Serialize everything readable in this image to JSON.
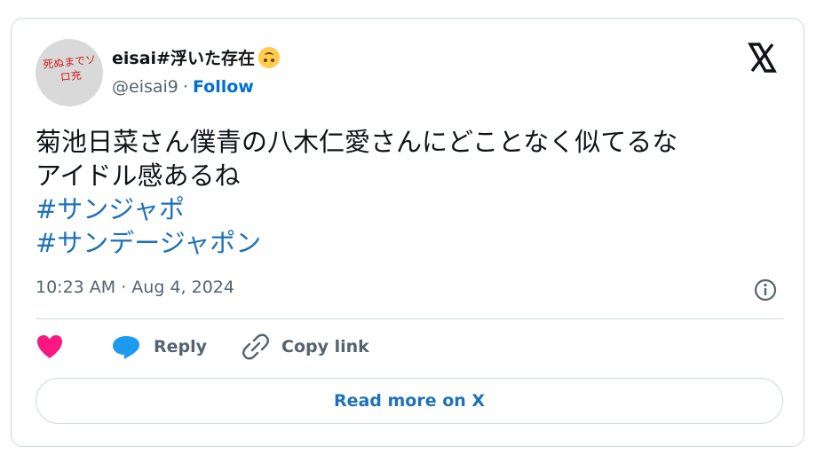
{
  "author": {
    "avatar_text": "死ぬまでソロ充",
    "display_name": "eisai#浮いた存在",
    "emoji_icon": "upside-down-face-icon",
    "handle": "@eisai9",
    "separator": "·",
    "follow_label": "Follow"
  },
  "tweet": {
    "text_line1": "菊池日菜さん僕青の八木仁愛さんにどことなく似てるな",
    "text_line2": "アイドル感あるね",
    "hashtag1": "#サンジャポ",
    "hashtag2": "#サンデージャポン",
    "timestamp": "10:23 AM · Aug 4, 2024"
  },
  "actions": {
    "reply_label": "Reply",
    "copy_link_label": "Copy link",
    "read_more_label": "Read more on X"
  },
  "colors": {
    "link": "#1d72b8",
    "heart": "#f91880",
    "reply_icon": "#1d9bf0"
  }
}
